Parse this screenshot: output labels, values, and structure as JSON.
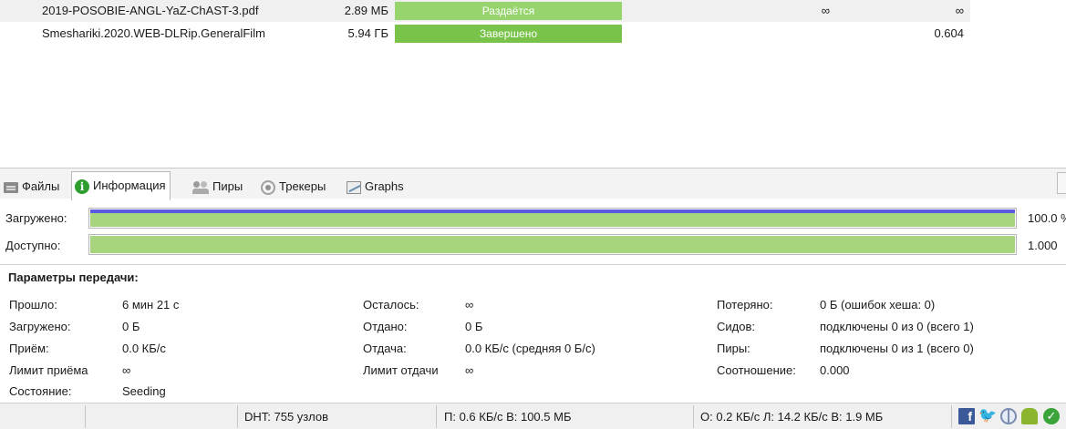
{
  "torrents": [
    {
      "name": "2019-POSOBIE-ANGL-YaZ-ChAST-3.pdf",
      "size": "2.89 МБ",
      "status": "Раздаётся",
      "col_a": "∞",
      "col_b": "∞"
    },
    {
      "name": "Smeshariki.2020.WEB-DLRip.GeneralFilm",
      "size": "5.94 ГБ",
      "status": "Завершено",
      "col_a": "",
      "col_b": "0.604"
    }
  ],
  "tabs": [
    {
      "label": "Файлы",
      "icon": "files-icon"
    },
    {
      "label": "Информация",
      "icon": "info-icon",
      "active": true
    },
    {
      "label": "Пиры",
      "icon": "peers-icon"
    },
    {
      "label": "Трекеры",
      "icon": "trackers-icon"
    },
    {
      "label": "Graphs",
      "icon": "graphs-icon"
    }
  ],
  "progress": {
    "downloaded": {
      "label": "Загружено:",
      "value": "100.0 %",
      "fraction": 1.0
    },
    "available": {
      "label": "Доступно:",
      "value": "1.000",
      "fraction": 1.0
    }
  },
  "transfer": {
    "title": "Параметры передачи:",
    "col1": [
      {
        "label": "Прошло:",
        "value": "6 мин 21 с"
      },
      {
        "label": "Загружено:",
        "value": "0 Б"
      },
      {
        "label": "Приём:",
        "value": "0.0 КБ/с"
      },
      {
        "label": "Лимит приёма",
        "value": "∞"
      },
      {
        "label": "Состояние:",
        "value": "Seeding"
      }
    ],
    "col2": [
      {
        "label": "Осталось:",
        "value": "∞"
      },
      {
        "label": "Отдано:",
        "value": "0 Б"
      },
      {
        "label": "Отдача:",
        "value": "0.0 КБ/с (средняя 0 Б/с)"
      },
      {
        "label": "Лимит отдачи",
        "value": "∞"
      }
    ],
    "col3": [
      {
        "label": "Потеряно:",
        "value": "0 Б (ошибок хеша: 0)"
      },
      {
        "label": "Сидов:",
        "value": "подключены 0 из 0 (всего 1)"
      },
      {
        "label": "Пиры:",
        "value": "подключены 0 из 1 (всего 0)"
      },
      {
        "label": "Соотношение:",
        "value": "0.000"
      }
    ]
  },
  "statusbar": {
    "dht": "DHT: 755 узлов",
    "down": "П: 0.6 КБ/с В: 100.5 МБ",
    "up": "О: 0.2 КБ/с Л: 14.2 КБ/с В: 1.9 МБ",
    "icons": [
      "facebook-icon",
      "twitter-icon",
      "web-icon",
      "android-icon",
      "connection-ok-icon"
    ]
  },
  "colors": {
    "seeding_bar": "#97d46e",
    "completed_bar": "#79c34a",
    "progress_fill": "#a6d57d",
    "download_accent": "#5b5be1"
  }
}
